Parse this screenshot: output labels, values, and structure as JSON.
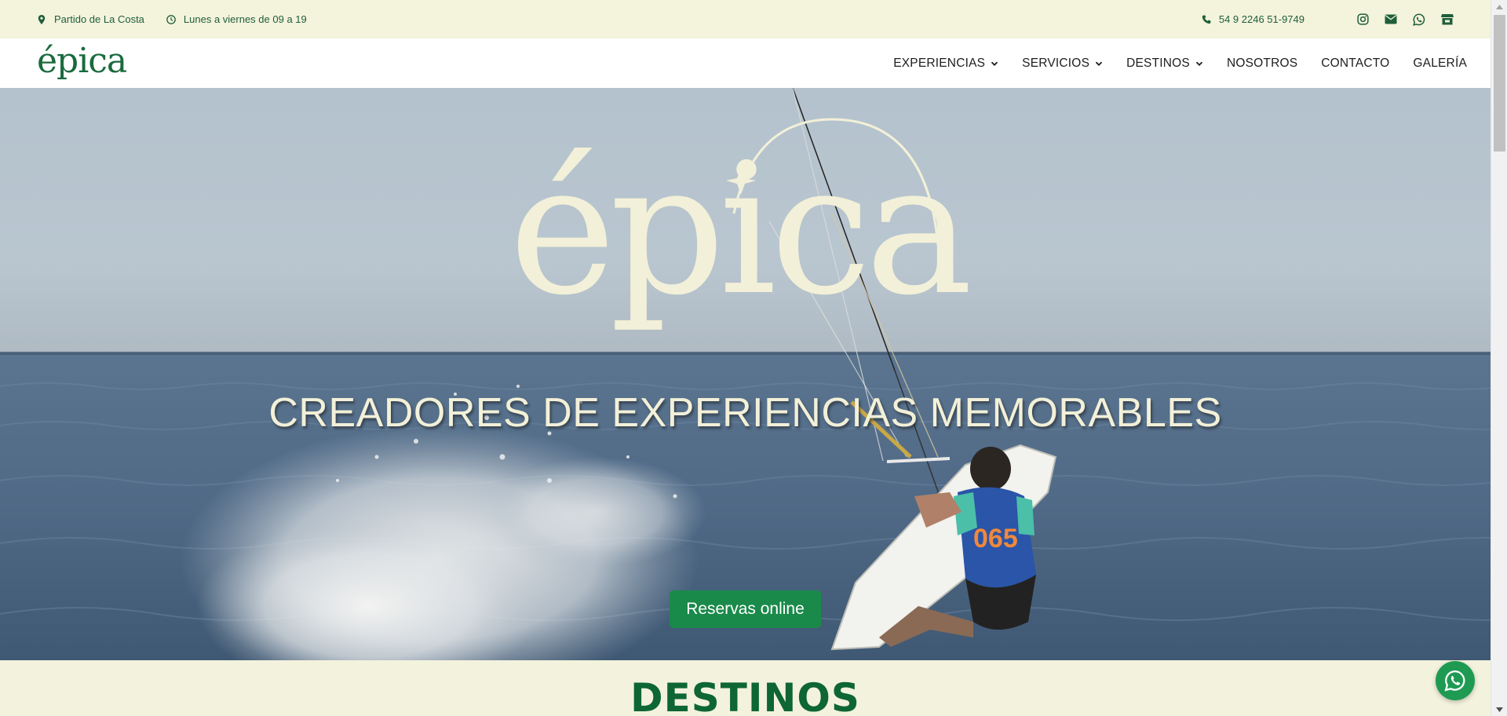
{
  "topbar": {
    "location": "Partido de La Costa",
    "hours": "Lunes a viernes de 09 a 19",
    "phone": "54 9 2246 51-9749",
    "social_icons": [
      "instagram-icon",
      "email-icon",
      "whatsapp-icon",
      "store-icon"
    ]
  },
  "header": {
    "logo": "épica",
    "nav": [
      {
        "label": "EXPERIENCIAS",
        "dropdown": true
      },
      {
        "label": "SERVICIOS",
        "dropdown": true
      },
      {
        "label": "DESTINOS",
        "dropdown": true
      },
      {
        "label": "NOSOTROS",
        "dropdown": false
      },
      {
        "label": "CONTACTO",
        "dropdown": false
      },
      {
        "label": "GALERÍA",
        "dropdown": false
      }
    ]
  },
  "hero": {
    "logo_text": "épica",
    "tagline": "CREADORES DE EXPERIENCIAS MEMORABLES",
    "cta_label": "Reservas online",
    "rider_number": "065"
  },
  "section": {
    "title": "DESTINOS"
  },
  "colors": {
    "brand_green": "#1a6a3e",
    "button_green": "#1a8a4a",
    "cream": "#f3f2dc",
    "tagline_color": "#f2f0d8"
  }
}
